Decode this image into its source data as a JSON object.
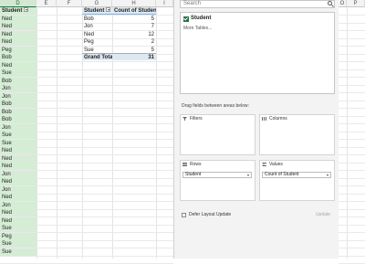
{
  "columns": [
    "D",
    "E",
    "F",
    "G",
    "H",
    "I",
    "O",
    "P"
  ],
  "column_d_values": [
    "Student",
    "Ned",
    "Ned",
    "Ned",
    "Ned",
    "Peg",
    "Bob",
    "Ned",
    "Sue",
    "Bob",
    "Jon",
    "Jon",
    "Bob",
    "Bob",
    "Bob",
    "Jon",
    "Sue",
    "Sue",
    "Ned",
    "Ned",
    "Ned",
    "Jon",
    "Ned",
    "Jon",
    "Ned",
    "Jon",
    "Ned",
    "Ned",
    "Sue",
    "Peg",
    "Sue",
    "Sue"
  ],
  "pivot": {
    "header_row": "Student",
    "header_value": "Count of Student",
    "rows": [
      {
        "label": "Bob",
        "value": "5"
      },
      {
        "label": "Jon",
        "value": "7"
      },
      {
        "label": "Ned",
        "value": "12"
      },
      {
        "label": "Peg",
        "value": "2"
      },
      {
        "label": "Sue",
        "value": "5"
      }
    ],
    "total_label": "Grand Total",
    "total_value": "31"
  },
  "pane": {
    "search_placeholder": "Search",
    "field": "Student",
    "more_tables": "More Tables...",
    "drag_text": "Drag fields between areas below:",
    "filters": "Filters",
    "columns": "Columns",
    "rows": "Rows",
    "values": "Values",
    "rows_chip": "Student",
    "values_chip": "Count of Student",
    "defer_label": "Defer Layout Update",
    "update_label": "Update"
  },
  "colors": {
    "accent": "#217346",
    "pivot_header": "#dde8f2",
    "selected_column": "#d5ecd5"
  }
}
